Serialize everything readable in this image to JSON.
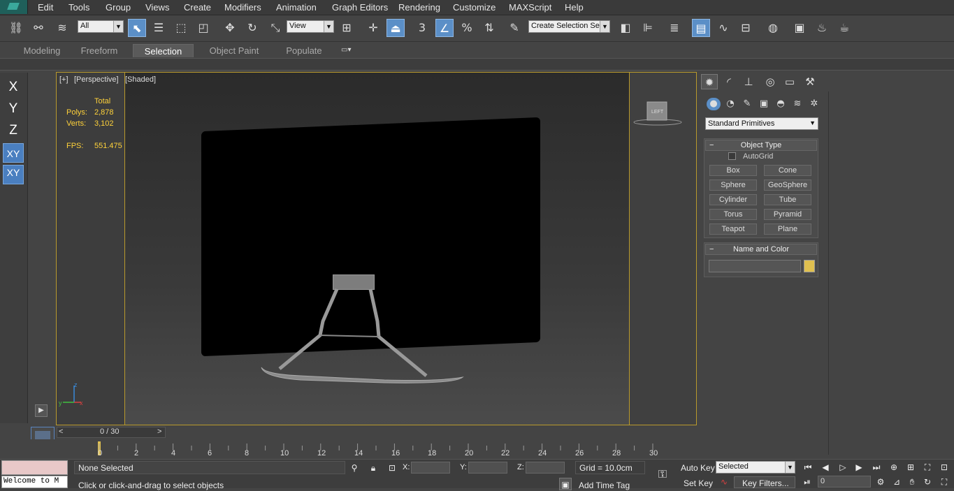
{
  "menu": [
    "Edit",
    "Tools",
    "Group",
    "Views",
    "Create",
    "Modifiers",
    "Animation",
    "Graph Editors",
    "Rendering",
    "Customize",
    "MAXScript",
    "Help"
  ],
  "toolbar": {
    "filter_select": "All",
    "coord_select": "View",
    "snap_value": "3",
    "named_selection": "Create Selection Se"
  },
  "ribbon": {
    "tabs": [
      "Modeling",
      "Freeform",
      "Selection",
      "Object Paint",
      "Populate"
    ],
    "active_tab": "Selection"
  },
  "axis_constraints": [
    "X",
    "Y",
    "Z",
    "XY",
    "XY"
  ],
  "viewport": {
    "label_plus": "[+]",
    "label_view": "[Perspective]",
    "label_shading": "[Shaded]",
    "stats": {
      "total_label": "Total",
      "polys_label": "Polys:",
      "polys_value": "2,878",
      "verts_label": "Verts:",
      "verts_value": "3,102",
      "fps_label": "FPS:",
      "fps_value": "551.475"
    },
    "gizmo": {
      "z": "z",
      "y": "y",
      "x": "x"
    },
    "navcube_label": "LEFT"
  },
  "command_panel": {
    "category": "Standard Primitives",
    "object_type_title": "Object Type",
    "autogrid_label": "AutoGrid",
    "primitives": [
      "Box",
      "Cone",
      "Sphere",
      "GeoSphere",
      "Cylinder",
      "Tube",
      "Torus",
      "Pyramid",
      "Teapot",
      "Plane"
    ],
    "name_color_title": "Name and Color",
    "swatch_color": "#e0c050"
  },
  "timeline": {
    "frame_counter": "0 / 30",
    "prev": "<",
    "next": ">",
    "ticks": [
      "0",
      "2",
      "4",
      "6",
      "8",
      "10",
      "12",
      "14",
      "16",
      "18",
      "20",
      "22",
      "24",
      "26",
      "28",
      "30"
    ]
  },
  "status": {
    "maxscript_text": "Welcome to M",
    "selection_status": "None Selected",
    "prompt": "Click or click-and-drag to select objects",
    "x_label": "X:",
    "y_label": "Y:",
    "z_label": "Z:",
    "grid": "Grid = 10.0cm",
    "add_time_tag": "Add Time Tag",
    "auto_key": "Auto Key",
    "set_key": "Set Key",
    "key_mode_select": "Selected",
    "key_filters": "Key Filters...",
    "current_frame": "0"
  }
}
